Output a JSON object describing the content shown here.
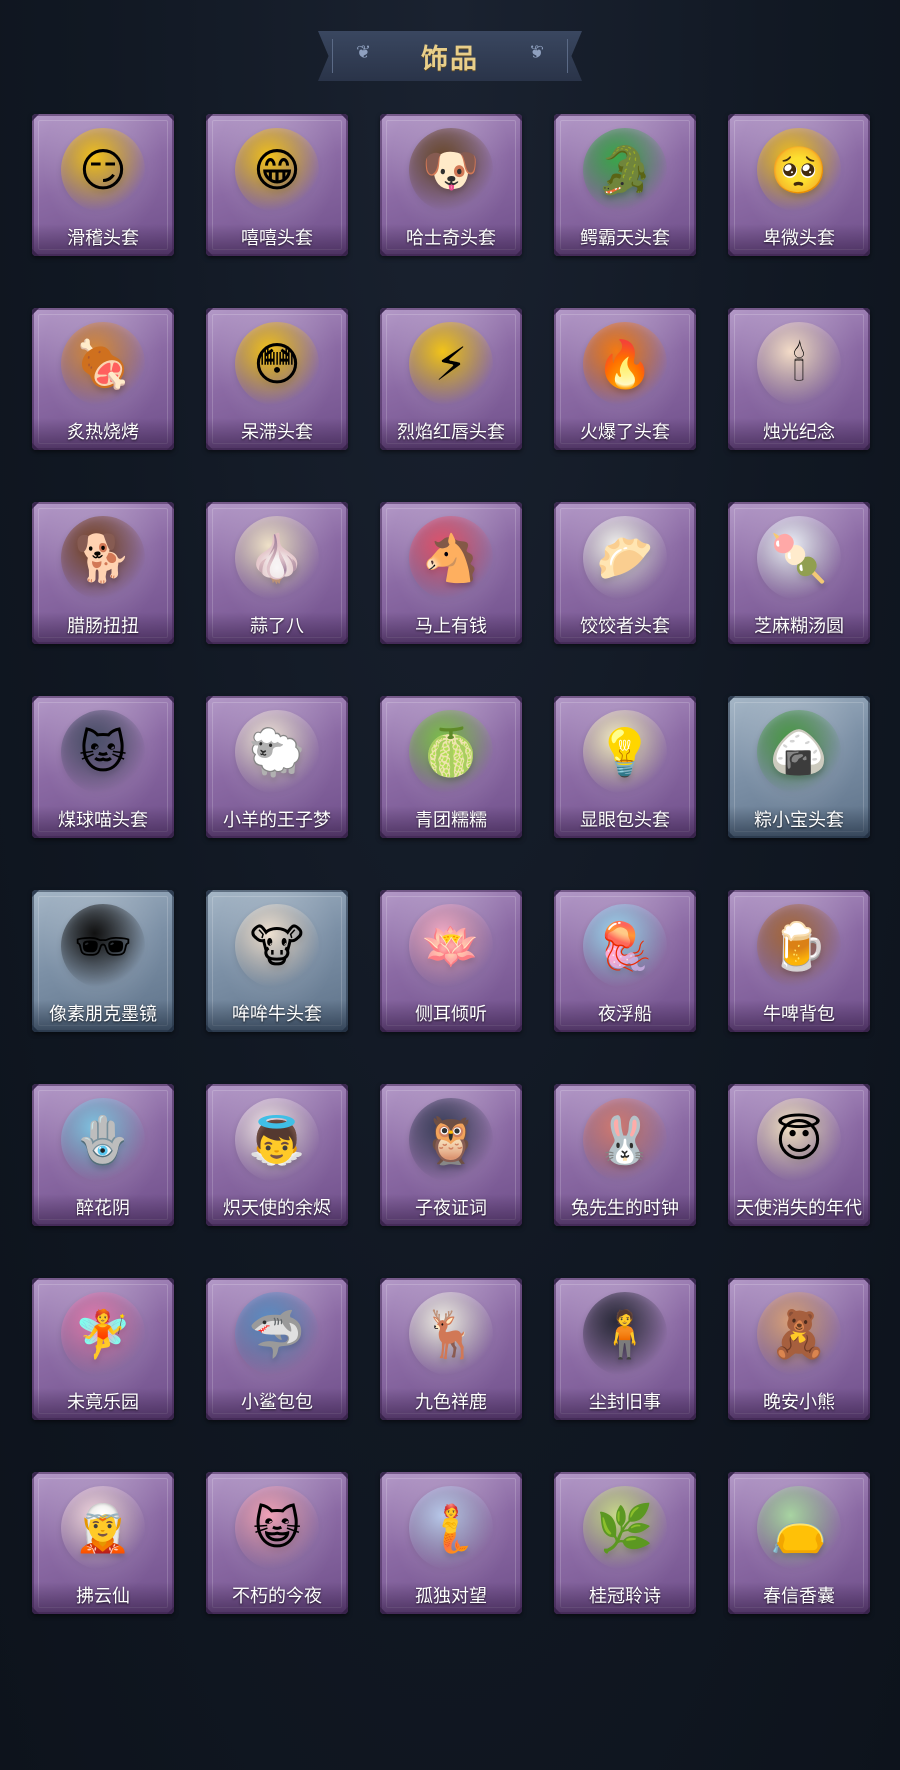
{
  "header": {
    "title": "饰品"
  },
  "colors": {
    "accent_gold": "#e9cf8a",
    "card_purple": "#8b6aa4",
    "card_blue": "#7c90a6",
    "background": "#111823"
  },
  "items": [
    {
      "label": "滑稽头套",
      "icon": "funny-face-mask-icon",
      "glyph": "😏",
      "tint": "#f3c21a",
      "rarity": "purple"
    },
    {
      "label": "嘻嘻头套",
      "icon": "grin-face-mask-icon",
      "glyph": "😁",
      "tint": "#f3c21a",
      "rarity": "purple"
    },
    {
      "label": "哈士奇头套",
      "icon": "husky-mask-icon",
      "glyph": "🐶",
      "tint": "#6b4a2e",
      "rarity": "purple"
    },
    {
      "label": "鳄霸天头套",
      "icon": "crocodile-mask-icon",
      "glyph": "🐊",
      "tint": "#3aa64a",
      "rarity": "purple"
    },
    {
      "label": "卑微头套",
      "icon": "humble-face-mask-icon",
      "glyph": "🥺",
      "tint": "#f3c21a",
      "rarity": "purple"
    },
    {
      "label": "炙热烧烤",
      "icon": "bbq-meat-mask-icon",
      "glyph": "🍖",
      "tint": "#d98a3a",
      "rarity": "purple"
    },
    {
      "label": "呆滞头套",
      "icon": "dazed-face-mask-icon",
      "glyph": "😳",
      "tint": "#f3c21a",
      "rarity": "purple"
    },
    {
      "label": "烈焰红唇头套",
      "icon": "pikachu-mask-icon",
      "glyph": "⚡",
      "tint": "#f2c419",
      "rarity": "purple"
    },
    {
      "label": "火爆了头套",
      "icon": "fire-mask-icon",
      "glyph": "🔥",
      "tint": "#f57a12",
      "rarity": "purple"
    },
    {
      "label": "烛光纪念",
      "icon": "candle-mask-icon",
      "glyph": "🕯",
      "tint": "#f4dcc8",
      "rarity": "purple"
    },
    {
      "label": "腊肠扭扭",
      "icon": "dachshund-mask-icon",
      "glyph": "🐕",
      "tint": "#7a4526",
      "rarity": "purple"
    },
    {
      "label": "蒜了八",
      "icon": "garlic-mask-icon",
      "glyph": "🧄",
      "tint": "#efe1c8",
      "rarity": "purple"
    },
    {
      "label": "马上有钱",
      "icon": "pink-horse-mask-icon",
      "glyph": "🐴",
      "tint": "#e2526c",
      "rarity": "purple"
    },
    {
      "label": "饺饺者头套",
      "icon": "dumpling-mask-icon",
      "glyph": "🥟",
      "tint": "#f2f2ee",
      "rarity": "purple"
    },
    {
      "label": "芝麻糊汤圆",
      "icon": "tangyuan-mask-icon",
      "glyph": "🍡",
      "tint": "#eef2fa",
      "rarity": "purple"
    },
    {
      "label": "煤球喵头套",
      "icon": "gray-cat-mask-icon",
      "glyph": "🐱",
      "tint": "#4a4f6a",
      "rarity": "purple"
    },
    {
      "label": "小羊的王子梦",
      "icon": "sheep-prince-mask-icon",
      "glyph": "🐑",
      "tint": "#f1e4da",
      "rarity": "purple"
    },
    {
      "label": "青团糯糯",
      "icon": "qingtuan-mask-icon",
      "glyph": "🍈",
      "tint": "#7dc04a",
      "rarity": "purple"
    },
    {
      "label": "显眼包头套",
      "icon": "bun-crown-mask-icon",
      "glyph": "💡",
      "tint": "#f4ecc2",
      "rarity": "purple"
    },
    {
      "label": "粽小宝头套",
      "icon": "zongzi-mask-icon",
      "glyph": "🍙",
      "tint": "#4a9a46",
      "rarity": "blue"
    },
    {
      "label": "像素朋克墨镜",
      "icon": "pixel-sunglasses-icon",
      "glyph": "🕶",
      "tint": "#111111",
      "rarity": "blue"
    },
    {
      "label": "哞哞牛头套",
      "icon": "cow-mask-icon",
      "glyph": "🐮",
      "tint": "#f0e2d2",
      "rarity": "blue"
    },
    {
      "label": "侧耳倾听",
      "icon": "lotus-earring-icon",
      "glyph": "🪷",
      "tint": "#f1a9c4",
      "rarity": "purple"
    },
    {
      "label": "夜浮船",
      "icon": "jellyfish-icon",
      "glyph": "🪼",
      "tint": "#9cd6f2",
      "rarity": "purple"
    },
    {
      "label": "牛啤背包",
      "icon": "beer-cow-backpack-icon",
      "glyph": "🍺",
      "tint": "#a8683a",
      "rarity": "purple"
    },
    {
      "label": "醉花阴",
      "icon": "dreamcatcher-icon",
      "glyph": "🪬",
      "tint": "#7fc3e2",
      "rarity": "purple"
    },
    {
      "label": "炽天使的余烬",
      "icon": "angel-doll-icon",
      "glyph": "👼",
      "tint": "#f3e5ea",
      "rarity": "purple"
    },
    {
      "label": "子夜证词",
      "icon": "crow-doll-icon",
      "glyph": "🦉",
      "tint": "#3b3f5c",
      "rarity": "purple"
    },
    {
      "label": "兔先生的时钟",
      "icon": "rabbit-clock-icon",
      "glyph": "🐰",
      "tint": "#d27a72",
      "rarity": "purple"
    },
    {
      "label": "天使消失的年代",
      "icon": "angel-girl-icon",
      "glyph": "😇",
      "tint": "#f2e0c4",
      "rarity": "purple"
    },
    {
      "label": "未竟乐园",
      "icon": "paradise-girl-doll-icon",
      "glyph": "🧚",
      "tint": "#e27ab0",
      "rarity": "purple"
    },
    {
      "label": "小鲨包包",
      "icon": "shark-pendant-icon",
      "glyph": "🦈",
      "tint": "#5a8ec6",
      "rarity": "purple"
    },
    {
      "label": "九色祥鹿",
      "icon": "deer-pendant-icon",
      "glyph": "🦌",
      "tint": "#f1eee6",
      "rarity": "purple"
    },
    {
      "label": "尘封旧事",
      "icon": "boy-doll-pendant-icon",
      "glyph": "🧍",
      "tint": "#2a2a3a",
      "rarity": "purple"
    },
    {
      "label": "晚安小熊",
      "icon": "bear-pendant-icon",
      "glyph": "🧸",
      "tint": "#d9a07a",
      "rarity": "purple"
    },
    {
      "label": "拂云仙",
      "icon": "cloud-fairy-pendant-icon",
      "glyph": "🧝",
      "tint": "#f2d6df",
      "rarity": "purple"
    },
    {
      "label": "不朽的今夜",
      "icon": "pink-cat-pendant-icon",
      "glyph": "😺",
      "tint": "#f0a2b8",
      "rarity": "purple"
    },
    {
      "label": "孤独对望",
      "icon": "blue-girl-pendant-icon",
      "glyph": "🧜",
      "tint": "#b8c8ea",
      "rarity": "purple"
    },
    {
      "label": "桂冠聆诗",
      "icon": "laurel-girl-pendant-icon",
      "glyph": "🌿",
      "tint": "#c8d88a",
      "rarity": "purple"
    },
    {
      "label": "春信香囊",
      "icon": "sachet-pendant-icon",
      "glyph": "👝",
      "tint": "#a8d4a2",
      "rarity": "purple"
    }
  ]
}
